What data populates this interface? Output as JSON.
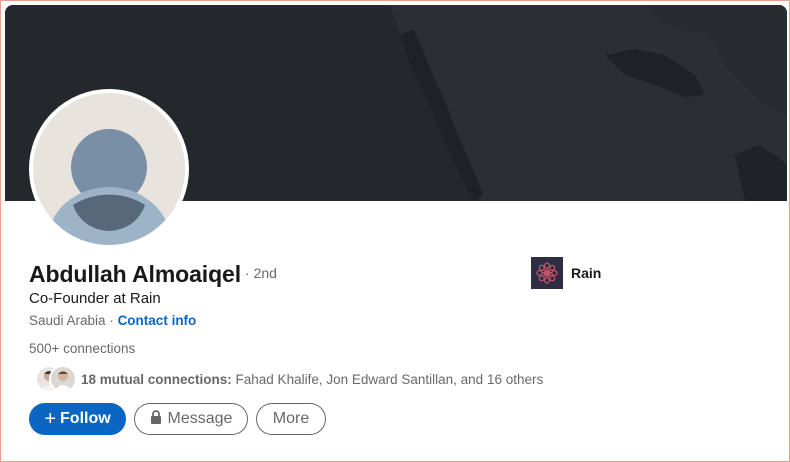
{
  "profile": {
    "name": "Abdullah Almoaiqel",
    "degree": "· 2nd",
    "headline": "Co-Founder at Rain",
    "location": "Saudi Arabia",
    "location_separator": " · ",
    "contact_link": "Contact info",
    "connections": "500+ connections"
  },
  "mutual": {
    "count_label": "18 mutual connections:",
    "names": " Fahad Khalife, Jon Edward Santillan, and 16 others"
  },
  "actions": {
    "follow": "Follow",
    "follow_icon": "+",
    "message": "Message",
    "more": "More"
  },
  "company": {
    "name": "Rain",
    "logo_icon": "rain-flower-logo-icon"
  },
  "colors": {
    "primary": "#0a66c2",
    "cover": "#24282c",
    "company_logo_bg": "#2f2d44",
    "company_logo_fg": "#c4566a"
  }
}
